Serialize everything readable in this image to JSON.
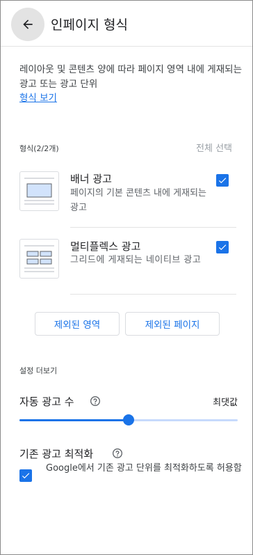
{
  "header": {
    "back_icon": "arrow-back-icon",
    "title": "인페이지 형식"
  },
  "intro": {
    "description": "레이아웃 및 콘텐츠 양에 따라 페이지 영역 내에 게재되는 광고 또는 광고 단위",
    "link": "형식 보기"
  },
  "formats": {
    "count_label": "형식(2/2개)",
    "select_all": "전체 선택",
    "items": [
      {
        "thumb_icon": "banner-ad-thumbnail-icon",
        "title": "배너 광고",
        "description": "페이지의 기본 콘텐츠 내에 게재되는 광고",
        "checked": true
      },
      {
        "thumb_icon": "multiplex-ad-thumbnail-icon",
        "title": "멀티플렉스 광고",
        "description": "그리드에 게재되는 네이티브 광고",
        "checked": true
      }
    ]
  },
  "buttons": {
    "excluded_areas": "제외된 영역",
    "excluded_pages": "제외된 페이지"
  },
  "more_settings": {
    "section_label": "설정 더보기",
    "auto_ads": {
      "label": "자동 광고 수",
      "help_icon": "help-circle-icon",
      "max_label": "최댓값",
      "slider_level": 0.5
    },
    "optimize": {
      "label": "기존 광고 최적화",
      "help_icon": "help-circle-icon",
      "checkbox_label": "Google에서 기존 광고 단위를 최적화하도록 허용함",
      "checked": true
    }
  },
  "colors": {
    "accent": "#1a73e8",
    "track": "#c6dafc",
    "divider": "#e3e3e3",
    "muted": "#9aa0a6"
  }
}
